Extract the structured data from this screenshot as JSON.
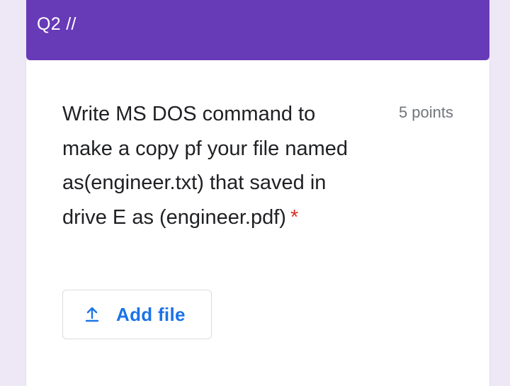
{
  "section": {
    "title": "Q2 //"
  },
  "question": {
    "text": "Write MS DOS command to make a copy pf your file named as(engineer.txt) that saved in drive E as (engineer.pdf)",
    "required_marker": "*",
    "points": "5 points"
  },
  "upload": {
    "icon": "upload-icon",
    "label": "Add file"
  },
  "colors": {
    "accent": "#673ab7",
    "background": "#ede7f6",
    "link_blue": "#1a73e8",
    "required_red": "#d93025"
  }
}
